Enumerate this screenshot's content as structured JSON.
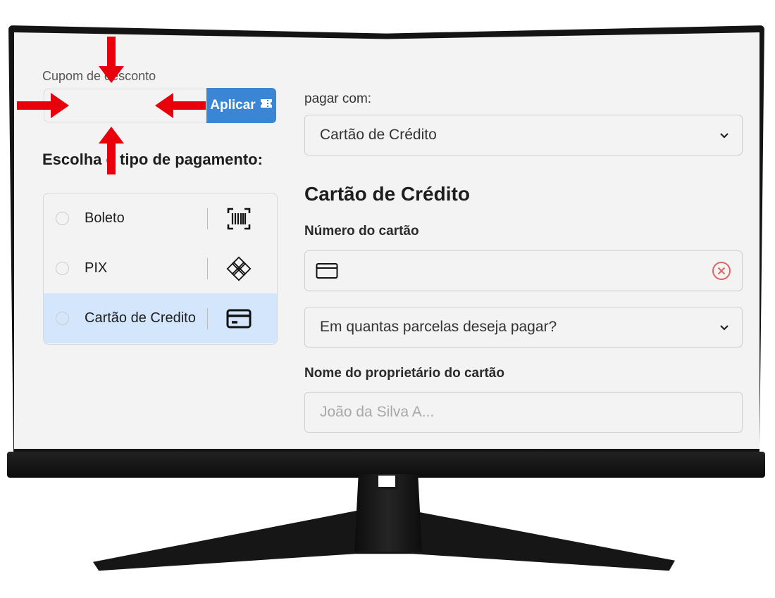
{
  "coupon": {
    "label": "Cupom de desconto",
    "input_value": "",
    "apply_label": "Aplicar"
  },
  "payment_type": {
    "title": "Escolha o tipo de pagamento:",
    "options": [
      {
        "label": "Boleto",
        "icon": "barcode-icon",
        "selected": false
      },
      {
        "label": "PIX",
        "icon": "pix-icon",
        "selected": false
      },
      {
        "label": "Cartão de Credito",
        "icon": "credit-card-icon",
        "selected": true
      }
    ]
  },
  "pay_with": {
    "label": "pagar com:",
    "selected": "Cartão de Crédito"
  },
  "card_form": {
    "title": "Cartão de Crédito",
    "number_label": "Número do cartão",
    "number_value": "",
    "installments_placeholder": "Em quantas parcelas deseja pagar?",
    "owner_label": "Nome do proprietário do cartão",
    "owner_placeholder": "João da Silva A..."
  },
  "colors": {
    "accent": "#3a86d4",
    "selected_row": "#d4e6fb",
    "arrow": "#e8000b",
    "clear_icon": "#e06666"
  }
}
